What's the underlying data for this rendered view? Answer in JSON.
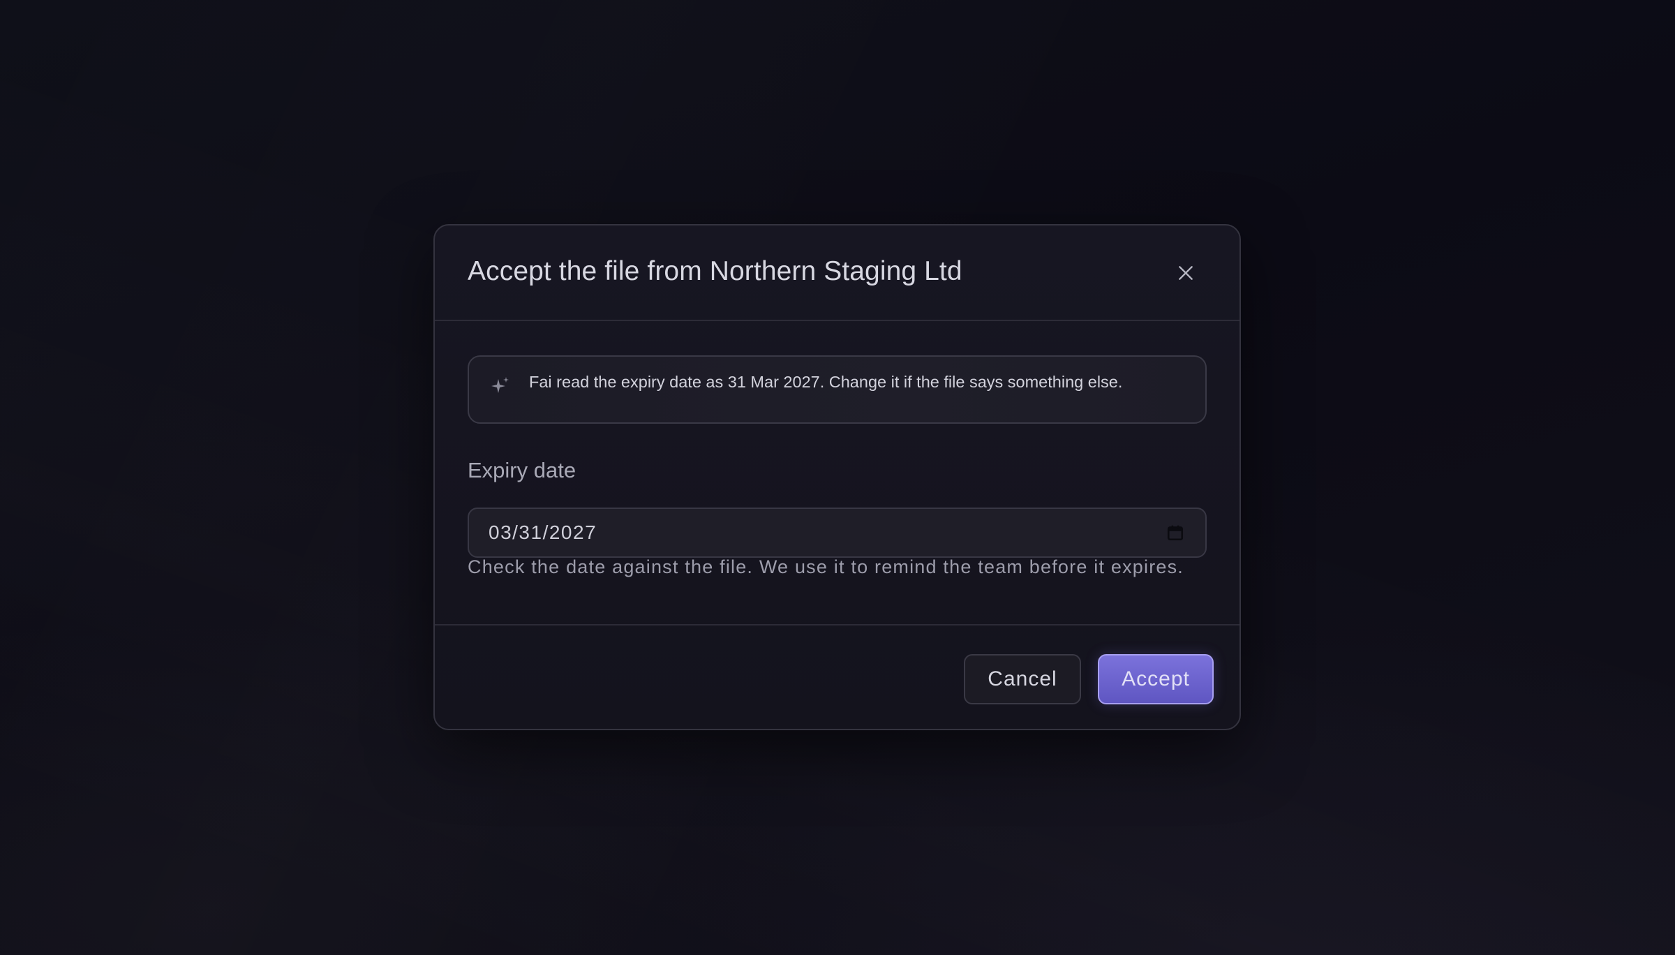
{
  "dialog": {
    "title": "Accept the file from Northern Staging Ltd",
    "close_icon": "close-icon",
    "notice": {
      "icon": "sparkle-icon",
      "text": "Fai read the expiry date as 31 Mar 2027. Change it if the file says something else."
    },
    "expiry_field": {
      "label": "Expiry date",
      "value": "03/31/2027",
      "icon": "calendar-icon",
      "helper": "Check the date against the file. We use it to remind the team before it expires."
    },
    "actions": {
      "cancel_label": "Cancel",
      "accept_label": "Accept"
    }
  },
  "colors": {
    "accent": "#6d64d0",
    "accent_border": "#a79ff0",
    "background": "#0e0e17",
    "surface": "#161520"
  }
}
